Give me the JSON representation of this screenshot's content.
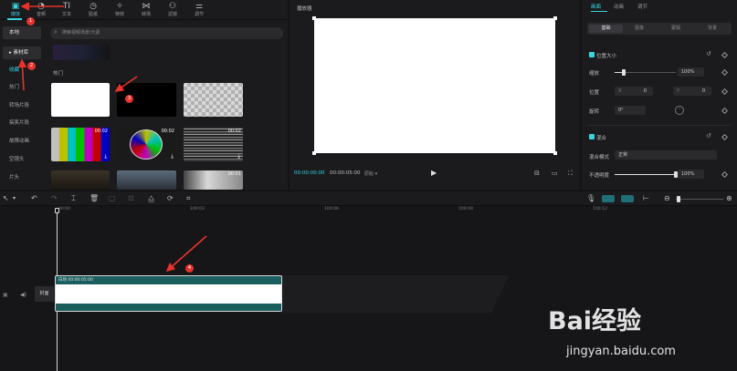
{
  "top_tools": [
    {
      "icon": "media-icon",
      "label": "媒体"
    },
    {
      "icon": "audio-icon",
      "label": "音频"
    },
    {
      "icon": "text-icon",
      "label": "文本"
    },
    {
      "icon": "sticker-icon",
      "label": "贴纸"
    },
    {
      "icon": "effects-icon",
      "label": "特效"
    },
    {
      "icon": "transition-icon",
      "label": "转场"
    },
    {
      "icon": "filter-icon",
      "label": "滤镜"
    },
    {
      "icon": "adjust-icon",
      "label": "调节"
    }
  ],
  "left_nav": [
    "本地",
    "素材库",
    "收藏",
    "热门",
    "转场片段",
    "搞笑片段",
    "故障动画",
    "空镜头",
    "片头"
  ],
  "search": {
    "placeholder": "搜索视频场景/元素"
  },
  "media_section": {
    "title": "热门"
  },
  "media_thumbs": [
    {
      "kind": "white"
    },
    {
      "kind": "black"
    },
    {
      "kind": "transparent"
    },
    {
      "kind": "colorbars",
      "duration": "00:02"
    },
    {
      "kind": "testcard",
      "duration": "00:02"
    },
    {
      "kind": "noise",
      "duration": "00:02"
    },
    {
      "kind": "photo"
    },
    {
      "kind": "photo"
    },
    {
      "kind": "photo",
      "duration": "00:01"
    }
  ],
  "player": {
    "title": "播放器",
    "current_time": "00:00:00:00",
    "total_time": "00:00:05:00",
    "ratio_label": "原始 ▾"
  },
  "right_panel": {
    "tabs": [
      "画面",
      "动画",
      "调节"
    ],
    "subtabs": [
      "基础",
      "抠像",
      "蒙版",
      "背景"
    ],
    "position_size_label": "位置大小",
    "scale_label": "缩放",
    "scale_value": "100%",
    "position_label": "位置",
    "x_label": "X",
    "x_value": "0",
    "y_label": "Y",
    "y_value": "0",
    "rotate_label": "旋转",
    "rotate_value": "0°",
    "blend_label": "混合",
    "blend_mode_label": "混合模式",
    "blend_mode_value": "正常",
    "opacity_label": "不透明度",
    "opacity_value": "100%",
    "scale_level": 0.15,
    "opacity_level": 1.0
  },
  "timeline": {
    "ruler": [
      "00:00",
      "100:03",
      "100:06",
      "100:09",
      "100:12"
    ],
    "clip_label": "白场  00:00:05:00",
    "cover_label": "封面"
  },
  "annotations": [
    "1",
    "2",
    "3",
    "4"
  ],
  "watermark": {
    "main": "Bai经验",
    "sub": "jingyan.baidu.com"
  },
  "colors": {
    "accent": "#38d5e0",
    "clip": "#1b5e5e",
    "annotation": "#e8332b"
  }
}
